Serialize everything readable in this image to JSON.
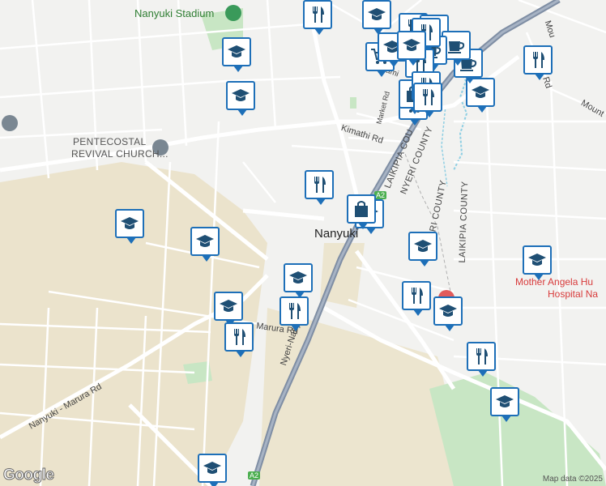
{
  "labels": {
    "stadium": "Nanyuki Stadium",
    "church_line1": "PENTECOSTAL",
    "church_line2": "REVIVAL CHURCH...",
    "kimathi": "Kimathi Rd",
    "market": "Market Rd",
    "laikipia_county_diag": "LAIKIPIA COU",
    "nyeri_county_diag": "NYERI COUNTY",
    "nyeri_county_vert": "NYERI COUNTY",
    "laikipia_county_vert": "LAIKIPIA COUNTY",
    "town": "Nanyuki",
    "hospital_line1": "Mother Angela Hu",
    "hospital_line2": "Hospital Na",
    "marura_rd": "Marura Rd",
    "nyeri_nanyuki_rd": "Nyeri-Nanyuki Rd",
    "nanyuki_marura_rd": "Nanyuki - Marura Rd",
    "mount_rd_top": "Mou",
    "mount_rd_right": "Mount",
    "rd_suffix": "Rd",
    "a2_badge": "A2",
    "a2_badge_top": "A2",
    "partial_label": "ami"
  },
  "footer": {
    "google": "Google",
    "map_data": "Map data ©2025"
  },
  "colors": {
    "background": "#f2f2f0",
    "park": "#c8e6c4",
    "land": "#ebe3cc",
    "road": "#ffffff",
    "highway": "#7f8ea4",
    "pin_border": "#1d6fb8",
    "icon": "#1f4f74",
    "river": "#8fcfe3"
  },
  "pins": [
    {
      "name": "school-marker",
      "icon": "graduation-cap-icon"
    },
    {
      "name": "school-marker",
      "icon": "graduation-cap-icon"
    },
    {
      "name": "school-marker",
      "icon": "graduation-cap-icon"
    },
    {
      "name": "school-marker",
      "icon": "graduation-cap-icon"
    },
    {
      "name": "school-marker",
      "icon": "graduation-cap-icon"
    },
    {
      "name": "school-marker",
      "icon": "graduation-cap-icon"
    },
    {
      "name": "school-marker",
      "icon": "graduation-cap-icon"
    },
    {
      "name": "school-marker",
      "icon": "graduation-cap-icon"
    },
    {
      "name": "school-marker",
      "icon": "graduation-cap-icon"
    },
    {
      "name": "school-marker",
      "icon": "graduation-cap-icon"
    },
    {
      "name": "school-marker",
      "icon": "graduation-cap-icon"
    },
    {
      "name": "school-marker",
      "icon": "graduation-cap-icon"
    },
    {
      "name": "school-marker",
      "icon": "graduation-cap-icon"
    },
    {
      "name": "school-marker",
      "icon": "graduation-cap-icon"
    },
    {
      "name": "restaurant-marker",
      "icon": "fork-knife-icon"
    },
    {
      "name": "restaurant-marker",
      "icon": "fork-knife-icon"
    },
    {
      "name": "restaurant-marker",
      "icon": "fork-knife-icon"
    },
    {
      "name": "restaurant-marker",
      "icon": "fork-knife-icon"
    },
    {
      "name": "restaurant-marker",
      "icon": "fork-knife-icon"
    },
    {
      "name": "restaurant-marker",
      "icon": "fork-knife-icon"
    },
    {
      "name": "restaurant-marker",
      "icon": "fork-knife-icon"
    },
    {
      "name": "restaurant-marker",
      "icon": "fork-knife-icon"
    },
    {
      "name": "shopping-marker",
      "icon": "shopping-cart-icon"
    },
    {
      "name": "shopping-marker",
      "icon": "shopping-cart-icon"
    },
    {
      "name": "shopping-marker",
      "icon": "shopping-bag-icon"
    },
    {
      "name": "shopping-marker",
      "icon": "shopping-bag-icon"
    },
    {
      "name": "cafe-marker",
      "icon": "coffee-cup-icon"
    },
    {
      "name": "cafe-marker",
      "icon": "coffee-cup-icon"
    },
    {
      "name": "cafe-marker",
      "icon": "coffee-cup-icon"
    },
    {
      "name": "restaurant-marker",
      "icon": "fork-knife-icon"
    },
    {
      "name": "restaurant-marker",
      "icon": "fork-knife-icon"
    },
    {
      "name": "restaurant-marker",
      "icon": "fork-knife-icon"
    },
    {
      "name": "restaurant-marker",
      "icon": "fork-knife-icon"
    },
    {
      "name": "school-marker",
      "icon": "graduation-cap-icon"
    },
    {
      "name": "school-marker",
      "icon": "graduation-cap-icon"
    },
    {
      "name": "shopping-marker",
      "icon": "shopping-bag-icon"
    }
  ]
}
